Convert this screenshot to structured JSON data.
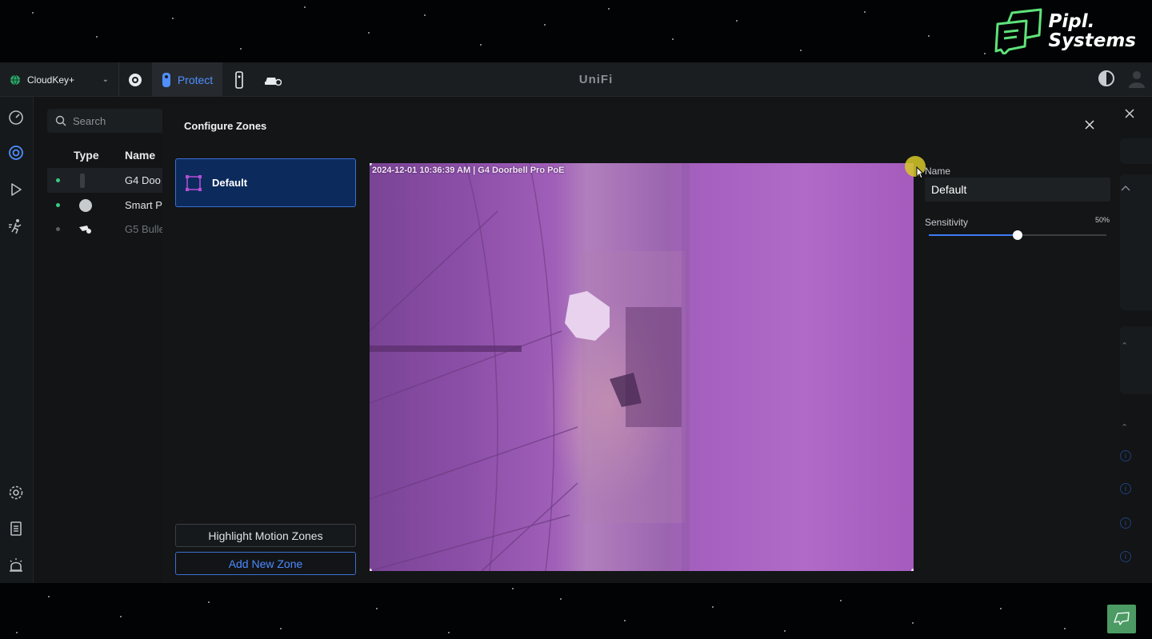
{
  "brand": {
    "line1": "Pipl.",
    "line2": "Systems",
    "logo_icon": "pipl-systems-logo-icon",
    "accent": "#5ee27a"
  },
  "topbar": {
    "console": "CloudKey+",
    "apps": [
      {
        "name": "network-app-icon"
      },
      {
        "name": "protect-app-icon",
        "label": "Protect",
        "active": true
      },
      {
        "name": "access-app-icon"
      },
      {
        "name": "vehicle-settings-icon"
      }
    ],
    "title": "UniFi",
    "accent": "#4f8fff"
  },
  "sidebar": {
    "icons": [
      "dashboard-icon",
      "devices-icon",
      "play-icon",
      "motion-detection-icon",
      "settings-icon",
      "logs-icon",
      "alarm-icon"
    ]
  },
  "device_list": {
    "search_placeholder": "Search",
    "columns": [
      "Type",
      "Name"
    ],
    "rows": [
      {
        "name": "G4 Doo",
        "status": "online",
        "icon": "doorbell-icon",
        "selected": true
      },
      {
        "name": "Smart P",
        "status": "online",
        "icon": "smart-sensor-icon",
        "selected": false
      },
      {
        "name": "G5 Bulle",
        "status": "offline",
        "icon": "bullet-camera-icon",
        "selected": false
      }
    ]
  },
  "modal": {
    "title": "Configure Zones",
    "zones": [
      {
        "label": "Default",
        "selected": true
      }
    ],
    "buttons": {
      "highlight": "Highlight Motion Zones",
      "add": "Add New Zone"
    },
    "camera": {
      "timestamp": "2024-12-01  10:36:39 AM  |  G4 Doorbell Pro PoE",
      "overlay_color": "#a45fc0"
    },
    "settings": {
      "name_label": "Name",
      "name_value": "Default",
      "sensitivity_label": "Sensitivity",
      "sensitivity_value_text": "50%",
      "sensitivity": 0.5
    }
  }
}
